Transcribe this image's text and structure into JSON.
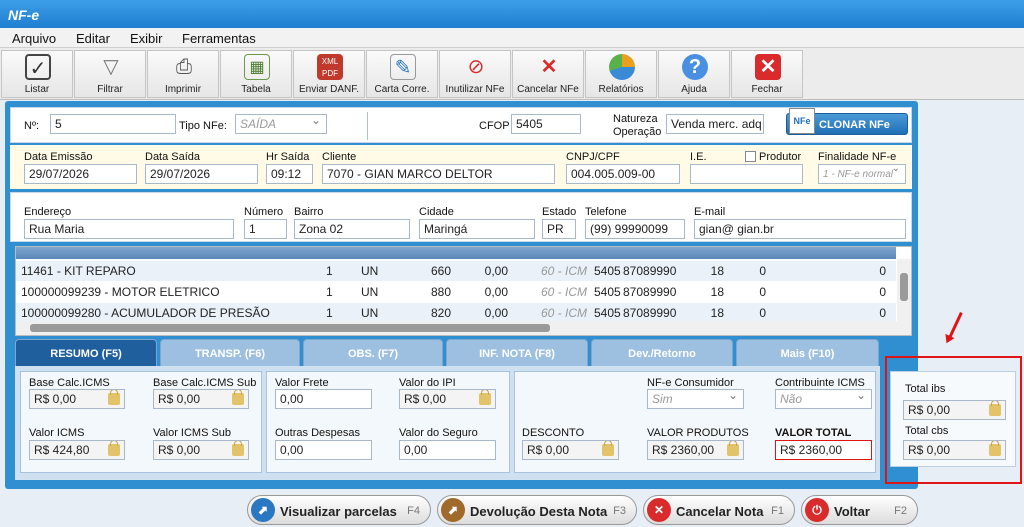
{
  "app": {
    "title": "NF-e"
  },
  "menu": [
    "Arquivo",
    "Editar",
    "Exibir",
    "Ferramentas"
  ],
  "toolbar": [
    {
      "label": "Listar",
      "icon": "checklist-icon"
    },
    {
      "label": "Filtrar",
      "icon": "funnel-icon"
    },
    {
      "label": "Imprimir",
      "icon": "printer-icon"
    },
    {
      "label": "Tabela",
      "icon": "table-icon"
    },
    {
      "label": "Enviar DANF.",
      "icon": "xml-pdf-icon"
    },
    {
      "label": "Carta Corre.",
      "icon": "document-pen-icon"
    },
    {
      "label": "Inutilizar NFe",
      "icon": "prohibited-icon"
    },
    {
      "label": "Cancelar NFe",
      "icon": "red-x-icon"
    },
    {
      "label": "Relatórios",
      "icon": "pie-chart-icon"
    },
    {
      "label": "Ajuda",
      "icon": "help-icon"
    },
    {
      "label": "Fechar",
      "icon": "close-icon"
    }
  ],
  "header": {
    "numero_label": "Nº:",
    "numero": "5",
    "tipo_label": "Tipo NFe:",
    "tipo": "SAÍDA",
    "cfop_label": "CFOP",
    "cfop": "5405",
    "natureza_label_1": "Natureza",
    "natureza_label_2": "Operação",
    "natureza": "Venda merc. adq",
    "clone_label": "CLONAR NFe",
    "clone_icon_text": "NFe"
  },
  "details": {
    "data_emissao_label": "Data Emissão",
    "data_emissao": "29/07/2026",
    "data_saida_label": "Data Saída",
    "data_saida": "29/07/2026",
    "hr_saida_label": "Hr Saída",
    "hr_saida": "09:12",
    "cliente_label": "Cliente",
    "cliente": "7070 - GIAN MARCO DELTOR",
    "cnpj_label": "CNPJ/CPF",
    "cnpj": "004.005.009-00",
    "ie_label": "I.E.",
    "ie": "",
    "produtor_label": "Produtor",
    "finalidade_label": "Finalidade NF-e",
    "finalidade": "1 - NF-e normal"
  },
  "address": {
    "endereco_label": "Endereço",
    "endereco": "Rua Maria",
    "numero_label": "Número",
    "numero": "1",
    "bairro_label": "Bairro",
    "bairro": "Zona 02",
    "cidade_label": "Cidade",
    "cidade": "Maringá",
    "estado_label": "Estado",
    "estado": "PR",
    "telefone_label": "Telefone",
    "telefone": "(99) 99990099",
    "email_label": "E-mail",
    "email": "gian@ gian.br"
  },
  "items": [
    {
      "desc": "11461 - KIT REPARO",
      "qtd": "1",
      "un": "UN",
      "valor": "660",
      "desconto": "0,00",
      "st": "60 - ICM",
      "cfop": "5405",
      "ncm": "87089990",
      "aliq": "18",
      "ipi": "0",
      "dev": "0"
    },
    {
      "desc": "100000099239 - MOTOR ELETRICO",
      "qtd": "1",
      "un": "UN",
      "valor": "880",
      "desconto": "0,00",
      "st": "60 - ICM",
      "cfop": "5405",
      "ncm": "87089990",
      "aliq": "18",
      "ipi": "0",
      "dev": "0"
    },
    {
      "desc": "100000099280 - ACUMULADOR DE PRESÃO",
      "qtd": "1",
      "un": "UN",
      "valor": "820",
      "desconto": "0,00",
      "st": "60 - ICM",
      "cfop": "5405",
      "ncm": "87089990",
      "aliq": "18",
      "ipi": "0",
      "dev": "0"
    }
  ],
  "tabs": [
    "RESUMO (F5)",
    "TRANSP. (F6)",
    "OBS. (F7)",
    "INF. NOTA (F8)",
    "Dev./Retorno",
    "Mais (F10)"
  ],
  "summary": {
    "base_icms_label": "Base Calc.ICMS",
    "base_icms": "R$ 0,00",
    "base_icms_sub_label": "Base Calc.ICMS Sub",
    "base_icms_sub": "R$ 0,00",
    "valor_icms_label": "Valor ICMS",
    "valor_icms": "R$ 424,80",
    "valor_icms_sub_label": "Valor ICMS Sub",
    "valor_icms_sub": "R$ 0,00",
    "frete_label": "Valor Frete",
    "frete": "0,00",
    "ipi_label": "Valor do IPI",
    "ipi": "R$ 0,00",
    "outras_label": "Outras Despesas",
    "outras": "0,00",
    "seguro_label": "Valor do Seguro",
    "seguro": "0,00",
    "consumidor_label": "NF-e Consumidor",
    "consumidor": "Sim",
    "contribuinte_label": "Contribuinte ICMS",
    "contribuinte": "Não",
    "desconto_label": "DESCONTO",
    "desconto": "R$ 0,00",
    "produtos_label": "VALOR PRODUTOS",
    "produtos": "R$ 2360,00",
    "total_label": "VALOR TOTAL",
    "total": "R$ 2360,00"
  },
  "ibs": {
    "ibs_label": "Total ibs",
    "ibs": "R$ 0,00",
    "cbs_label": "Total cbs",
    "cbs": "R$ 0,00"
  },
  "footer": [
    {
      "label": "Visualizar parcelas",
      "key": "F4",
      "color": "#2b78c2",
      "icon": "view-installments-icon"
    },
    {
      "label": "Devolução Desta Nota",
      "key": "F3",
      "color": "#a06a2a",
      "icon": "return-note-icon"
    },
    {
      "label": "Cancelar Nota",
      "key": "F1",
      "color": "#d92b2b",
      "icon": "cancel-icon"
    },
    {
      "label": "Voltar",
      "key": "F2",
      "color": "#d92b2b",
      "icon": "power-icon"
    }
  ],
  "colors": {
    "titlebar": "#1f7fd0",
    "frame": "#2f8fd0",
    "highlight": "#e01414"
  }
}
